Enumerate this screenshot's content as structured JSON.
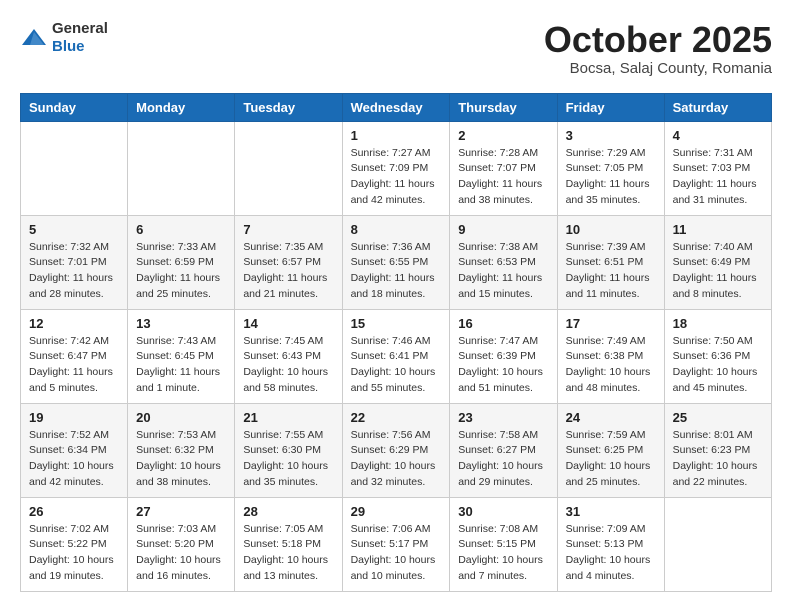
{
  "header": {
    "logo": {
      "text_general": "General",
      "text_blue": "Blue"
    },
    "month_title": "October 2025",
    "subtitle": "Bocsa, Salaj County, Romania"
  },
  "calendar": {
    "headers": [
      "Sunday",
      "Monday",
      "Tuesday",
      "Wednesday",
      "Thursday",
      "Friday",
      "Saturday"
    ],
    "weeks": [
      [
        {
          "day": "",
          "info": ""
        },
        {
          "day": "",
          "info": ""
        },
        {
          "day": "",
          "info": ""
        },
        {
          "day": "1",
          "info": "Sunrise: 7:27 AM\nSunset: 7:09 PM\nDaylight: 11 hours\nand 42 minutes."
        },
        {
          "day": "2",
          "info": "Sunrise: 7:28 AM\nSunset: 7:07 PM\nDaylight: 11 hours\nand 38 minutes."
        },
        {
          "day": "3",
          "info": "Sunrise: 7:29 AM\nSunset: 7:05 PM\nDaylight: 11 hours\nand 35 minutes."
        },
        {
          "day": "4",
          "info": "Sunrise: 7:31 AM\nSunset: 7:03 PM\nDaylight: 11 hours\nand 31 minutes."
        }
      ],
      [
        {
          "day": "5",
          "info": "Sunrise: 7:32 AM\nSunset: 7:01 PM\nDaylight: 11 hours\nand 28 minutes."
        },
        {
          "day": "6",
          "info": "Sunrise: 7:33 AM\nSunset: 6:59 PM\nDaylight: 11 hours\nand 25 minutes."
        },
        {
          "day": "7",
          "info": "Sunrise: 7:35 AM\nSunset: 6:57 PM\nDaylight: 11 hours\nand 21 minutes."
        },
        {
          "day": "8",
          "info": "Sunrise: 7:36 AM\nSunset: 6:55 PM\nDaylight: 11 hours\nand 18 minutes."
        },
        {
          "day": "9",
          "info": "Sunrise: 7:38 AM\nSunset: 6:53 PM\nDaylight: 11 hours\nand 15 minutes."
        },
        {
          "day": "10",
          "info": "Sunrise: 7:39 AM\nSunset: 6:51 PM\nDaylight: 11 hours\nand 11 minutes."
        },
        {
          "day": "11",
          "info": "Sunrise: 7:40 AM\nSunset: 6:49 PM\nDaylight: 11 hours\nand 8 minutes."
        }
      ],
      [
        {
          "day": "12",
          "info": "Sunrise: 7:42 AM\nSunset: 6:47 PM\nDaylight: 11 hours\nand 5 minutes."
        },
        {
          "day": "13",
          "info": "Sunrise: 7:43 AM\nSunset: 6:45 PM\nDaylight: 11 hours\nand 1 minute."
        },
        {
          "day": "14",
          "info": "Sunrise: 7:45 AM\nSunset: 6:43 PM\nDaylight: 10 hours\nand 58 minutes."
        },
        {
          "day": "15",
          "info": "Sunrise: 7:46 AM\nSunset: 6:41 PM\nDaylight: 10 hours\nand 55 minutes."
        },
        {
          "day": "16",
          "info": "Sunrise: 7:47 AM\nSunset: 6:39 PM\nDaylight: 10 hours\nand 51 minutes."
        },
        {
          "day": "17",
          "info": "Sunrise: 7:49 AM\nSunset: 6:38 PM\nDaylight: 10 hours\nand 48 minutes."
        },
        {
          "day": "18",
          "info": "Sunrise: 7:50 AM\nSunset: 6:36 PM\nDaylight: 10 hours\nand 45 minutes."
        }
      ],
      [
        {
          "day": "19",
          "info": "Sunrise: 7:52 AM\nSunset: 6:34 PM\nDaylight: 10 hours\nand 42 minutes."
        },
        {
          "day": "20",
          "info": "Sunrise: 7:53 AM\nSunset: 6:32 PM\nDaylight: 10 hours\nand 38 minutes."
        },
        {
          "day": "21",
          "info": "Sunrise: 7:55 AM\nSunset: 6:30 PM\nDaylight: 10 hours\nand 35 minutes."
        },
        {
          "day": "22",
          "info": "Sunrise: 7:56 AM\nSunset: 6:29 PM\nDaylight: 10 hours\nand 32 minutes."
        },
        {
          "day": "23",
          "info": "Sunrise: 7:58 AM\nSunset: 6:27 PM\nDaylight: 10 hours\nand 29 minutes."
        },
        {
          "day": "24",
          "info": "Sunrise: 7:59 AM\nSunset: 6:25 PM\nDaylight: 10 hours\nand 25 minutes."
        },
        {
          "day": "25",
          "info": "Sunrise: 8:01 AM\nSunset: 6:23 PM\nDaylight: 10 hours\nand 22 minutes."
        }
      ],
      [
        {
          "day": "26",
          "info": "Sunrise: 7:02 AM\nSunset: 5:22 PM\nDaylight: 10 hours\nand 19 minutes."
        },
        {
          "day": "27",
          "info": "Sunrise: 7:03 AM\nSunset: 5:20 PM\nDaylight: 10 hours\nand 16 minutes."
        },
        {
          "day": "28",
          "info": "Sunrise: 7:05 AM\nSunset: 5:18 PM\nDaylight: 10 hours\nand 13 minutes."
        },
        {
          "day": "29",
          "info": "Sunrise: 7:06 AM\nSunset: 5:17 PM\nDaylight: 10 hours\nand 10 minutes."
        },
        {
          "day": "30",
          "info": "Sunrise: 7:08 AM\nSunset: 5:15 PM\nDaylight: 10 hours\nand 7 minutes."
        },
        {
          "day": "31",
          "info": "Sunrise: 7:09 AM\nSunset: 5:13 PM\nDaylight: 10 hours\nand 4 minutes."
        },
        {
          "day": "",
          "info": ""
        }
      ]
    ]
  }
}
